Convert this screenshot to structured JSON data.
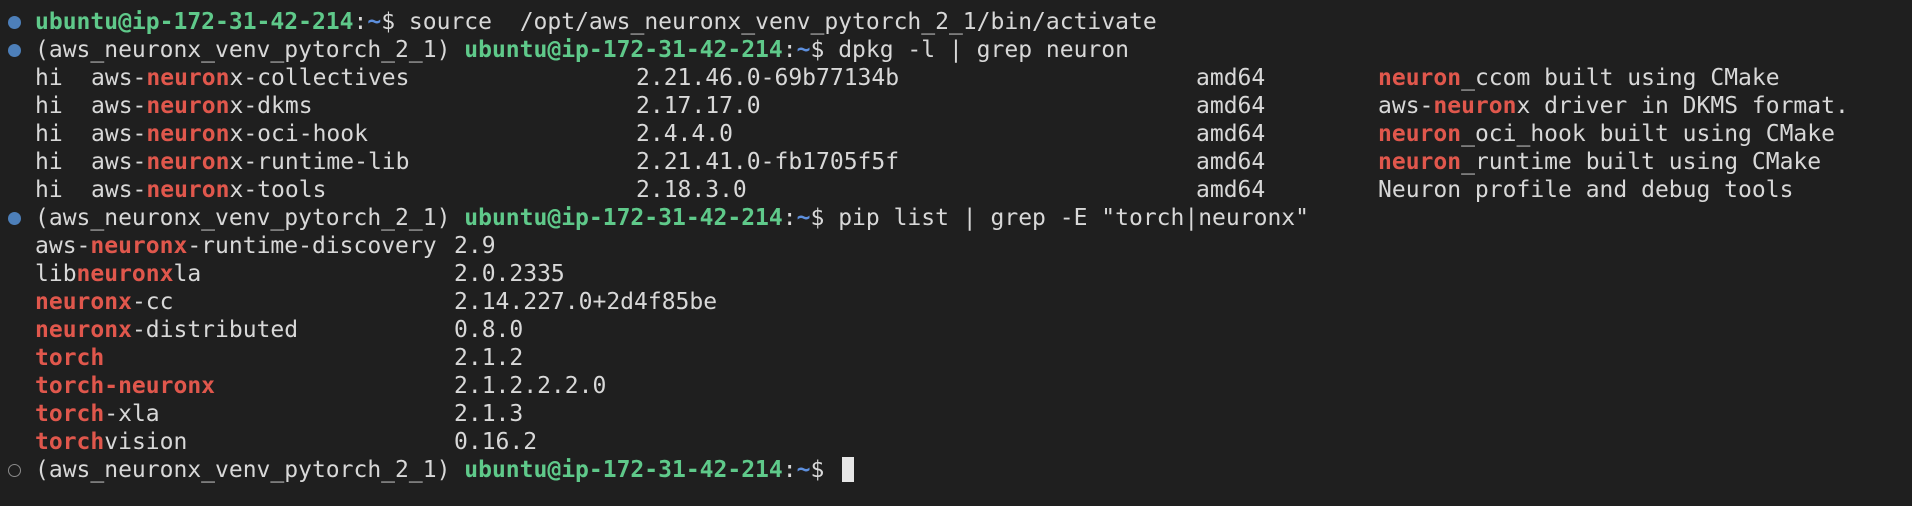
{
  "prompt": {
    "user_host": "ubuntu@ip-172-31-42-214",
    "sep": ":",
    "path": "~",
    "dollar": "$ ",
    "venv": "(aws_neuronx_venv_pytorch_2_1) "
  },
  "commands": {
    "activate": "source  /opt/aws_neuronx_venv_pytorch_2_1/bin/activate",
    "dpkg": "dpkg -l | grep neuron",
    "pip": "pip list | grep -E \"torch|neuronx\""
  },
  "dpkg_rows": [
    {
      "status": "hi",
      "name_pre": "aws-",
      "name_hl": "neuron",
      "name_post": "x-collectives",
      "version": "2.21.46.0-69b77134b",
      "arch": "amd64",
      "desc_pre": "",
      "desc_hl": "neuron",
      "desc_post": "_ccom built using CMake"
    },
    {
      "status": "hi",
      "name_pre": "aws-",
      "name_hl": "neuron",
      "name_post": "x-dkms",
      "version": "2.17.17.0",
      "arch": "amd64",
      "desc_pre": "aws-",
      "desc_hl": "neuron",
      "desc_post": "x driver in DKMS format."
    },
    {
      "status": "hi",
      "name_pre": "aws-",
      "name_hl": "neuron",
      "name_post": "x-oci-hook",
      "version": "2.4.4.0",
      "arch": "amd64",
      "desc_pre": "",
      "desc_hl": "neuron",
      "desc_post": "_oci_hook built using CMake"
    },
    {
      "status": "hi",
      "name_pre": "aws-",
      "name_hl": "neuron",
      "name_post": "x-runtime-lib",
      "version": "2.21.41.0-fb1705f5f",
      "arch": "amd64",
      "desc_pre": "",
      "desc_hl": "neuron",
      "desc_post": "_runtime built using CMake"
    },
    {
      "status": "hi",
      "name_pre": "aws-",
      "name_hl": "neuron",
      "name_post": "x-tools",
      "version": "2.18.3.0",
      "arch": "amd64",
      "desc_pre": "Neuron profile and debug tools",
      "desc_hl": "",
      "desc_post": ""
    }
  ],
  "pip_rows": [
    {
      "pre": "aws-",
      "hl": "neuronx",
      "post": "-runtime-discovery",
      "version": "2.9"
    },
    {
      "pre": "lib",
      "hl": "neuronx",
      "post": "la",
      "version": "2.0.2335"
    },
    {
      "pre": "",
      "hl": "neuronx",
      "post": "-cc",
      "version": "2.14.227.0+2d4f85be"
    },
    {
      "pre": "",
      "hl": "neuronx",
      "post": "-distributed",
      "version": "0.8.0"
    },
    {
      "pre": "",
      "hl": "torch",
      "post": "",
      "version": "2.1.2"
    },
    {
      "pre": "",
      "hl": "torch-neuronx",
      "post": "",
      "version": "2.1.2.2.2.0"
    },
    {
      "pre": "",
      "hl": "torch",
      "post": "-xla",
      "version": "2.1.3"
    },
    {
      "pre": "",
      "hl": "torch",
      "post": "vision",
      "version": "0.16.2"
    }
  ],
  "colors": {
    "background": "#1f1f1f",
    "text": "#d8d8d8",
    "user_host": "#5fc98a",
    "path": "#5d8fdd",
    "match_highlight": "#e0574c",
    "dot_done": "#4d7fb9"
  },
  "icons": {
    "decoration_done": "filled-circle",
    "decoration_pending": "hollow-circle",
    "cursor": "block-cursor"
  }
}
